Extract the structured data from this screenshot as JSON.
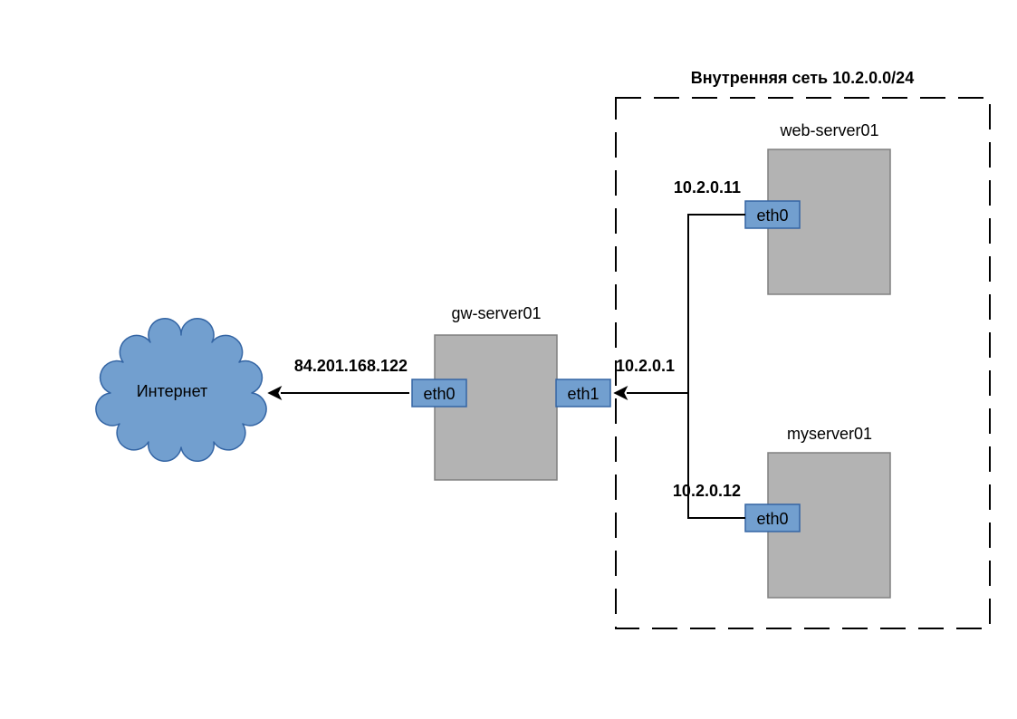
{
  "network": {
    "boundary_label": "Внутренняя сеть 10.2.0.0/24"
  },
  "cloud": {
    "label": "Интернет"
  },
  "gateway": {
    "name": "gw-server01",
    "eth0": {
      "label": "eth0",
      "ip": "84.201.168.122"
    },
    "eth1": {
      "label": "eth1",
      "ip": "10.2.0.1"
    }
  },
  "web": {
    "name": "web-server01",
    "eth0": {
      "label": "eth0",
      "ip": "10.2.0.11"
    }
  },
  "my": {
    "name": "myserver01",
    "eth0": {
      "label": "eth0",
      "ip": "10.2.0.12"
    }
  }
}
